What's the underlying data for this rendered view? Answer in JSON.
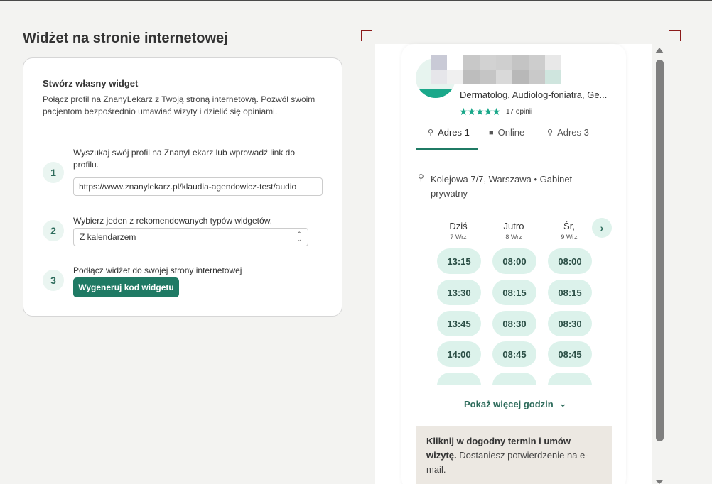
{
  "page": {
    "title": "Widżet na stronie internetowej"
  },
  "card": {
    "title": "Stwórz własny widget",
    "description": "Połącz profil na ZnanyLekarz z Twoją stroną internetową. Pozwól swoim pacjentom bezpośrednio umawiać wizyty i dzielić się opiniami.",
    "steps": [
      {
        "number": "1",
        "text": "Wyszukaj swój profil na ZnanyLekarz lub wprowadź link do profilu."
      },
      {
        "number": "2",
        "text": "Wybierz jeden z rekomendowanych typów widgetów."
      },
      {
        "number": "3",
        "text": "Podłącz widżet do swojej strony internetowej"
      }
    ],
    "url_value": "https://www.znanylekarz.pl/klaudia-agendowicz-test/audio",
    "widget_type_value": "Z kalendarzem",
    "generate_button": "Wygeneruj kod widgetu"
  },
  "widget": {
    "specialty": "Dermatolog, Audiolog-foniatra, Ge...",
    "rating_stars": "★★★★★",
    "reviews": "17 opinii",
    "tabs": [
      {
        "label": "Adres 1",
        "icon": "map-pin-icon"
      },
      {
        "label": "Online",
        "icon": "video-camera-icon"
      },
      {
        "label": "Adres 3",
        "icon": "map-pin-icon"
      }
    ],
    "address": "Kolejowa 7/7, Warszawa  •  Gabinet prywatny",
    "days": [
      {
        "name": "Dziś",
        "date": "7 Wrz"
      },
      {
        "name": "Jutro",
        "date": "8 Wrz"
      },
      {
        "name": "Śr,",
        "date": "9 Wrz"
      }
    ],
    "slots": [
      [
        "13:15",
        "13:30",
        "13:45",
        "14:00",
        ""
      ],
      [
        "08:00",
        "08:15",
        "08:30",
        "08:45",
        ""
      ],
      [
        "08:00",
        "08:15",
        "08:30",
        "08:45",
        ""
      ]
    ],
    "show_more": "Pokaż więcej godzin",
    "info_bold": "Kliknij w dogodny termin i umów wizytę.",
    "info_rest": " Dostaniesz potwierdzenie na e-mail."
  },
  "colors": {
    "accent": "#1f7a64",
    "slot_bg": "#dcf2eb",
    "star": "#1aa88a"
  }
}
